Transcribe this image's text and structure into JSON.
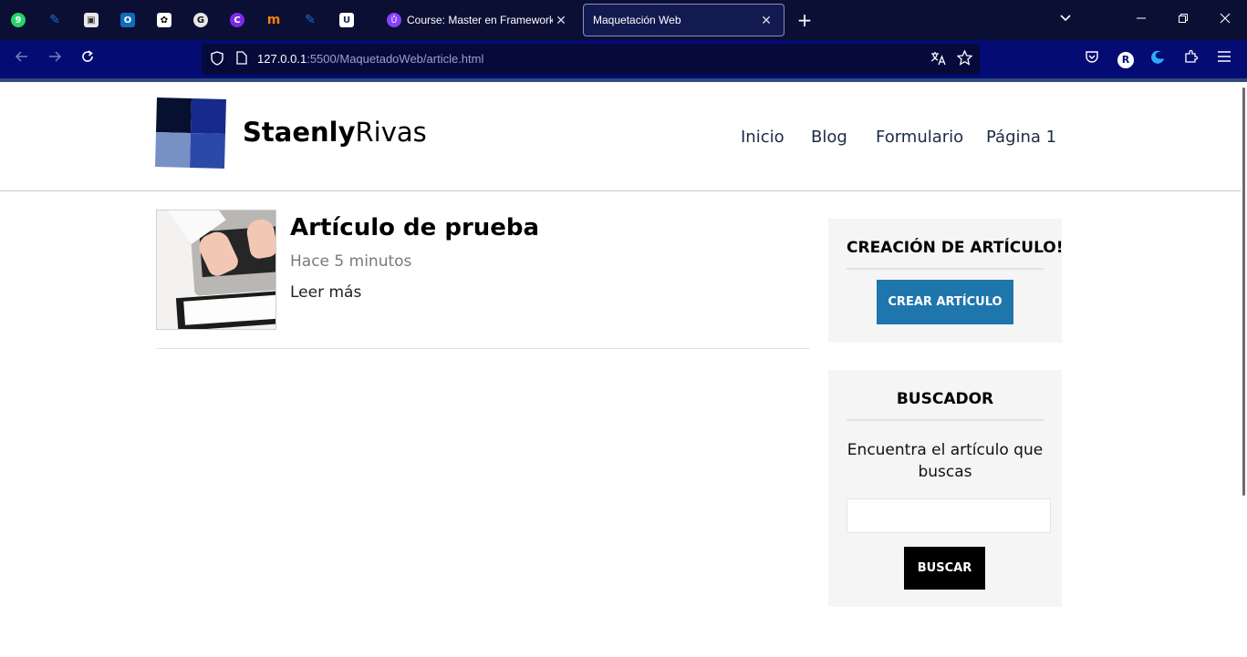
{
  "browser": {
    "pinned_tabs": [
      {
        "icon": "whatsapp-icon",
        "glyph": "9",
        "color": "#25d366"
      },
      {
        "icon": "notes-icon",
        "glyph": "✎",
        "color": "#1f6fd1"
      },
      {
        "icon": "contacts-icon",
        "glyph": "▣",
        "color": "#e8e8e8"
      },
      {
        "icon": "outlook-icon",
        "glyph": "O",
        "color": "#0f6cbd"
      },
      {
        "icon": "chatgpt-icon",
        "glyph": "✿",
        "color": "#ffffff"
      },
      {
        "icon": "grammarly-icon",
        "glyph": "G",
        "color": "#e6e6e6"
      },
      {
        "icon": "canva-icon",
        "glyph": "C",
        "color": "#7d2ae8"
      },
      {
        "icon": "moodle-icon",
        "glyph": "m",
        "color": "#f98012"
      },
      {
        "icon": "notes-icon",
        "glyph": "✎",
        "color": "#1f6fd1"
      },
      {
        "icon": "udemy-business-icon",
        "glyph": "U",
        "color": "#1e2a5a"
      }
    ],
    "tabs": [
      {
        "title": "Course: Master en Frameworks",
        "active": false,
        "close": "✕"
      },
      {
        "title": "Maquetación Web",
        "active": true,
        "close": "✕"
      }
    ],
    "new_tab": "+",
    "url_host": "127.0.0.1",
    "url_rest": ":5500/MaquetadoWeb/article.html"
  },
  "site": {
    "logo_bold": "Staenly",
    "logo_regular": "Rivas",
    "menu": [
      "Inicio",
      "Blog",
      "Formulario",
      "Página 1"
    ]
  },
  "article": {
    "title": "Artículo de prueba",
    "date": "Hace 5 minutos",
    "more": "Leer más"
  },
  "sidebar": {
    "create": {
      "title": "CREACIÓN DE ARTÍCULO!",
      "button": "CREAR ARTÍCULO",
      "button_color": "#1f76ad"
    },
    "search": {
      "title": "BUSCADOR",
      "description": "Encuentra el artículo que buscas",
      "input_value": "",
      "button": "BUSCAR"
    }
  }
}
